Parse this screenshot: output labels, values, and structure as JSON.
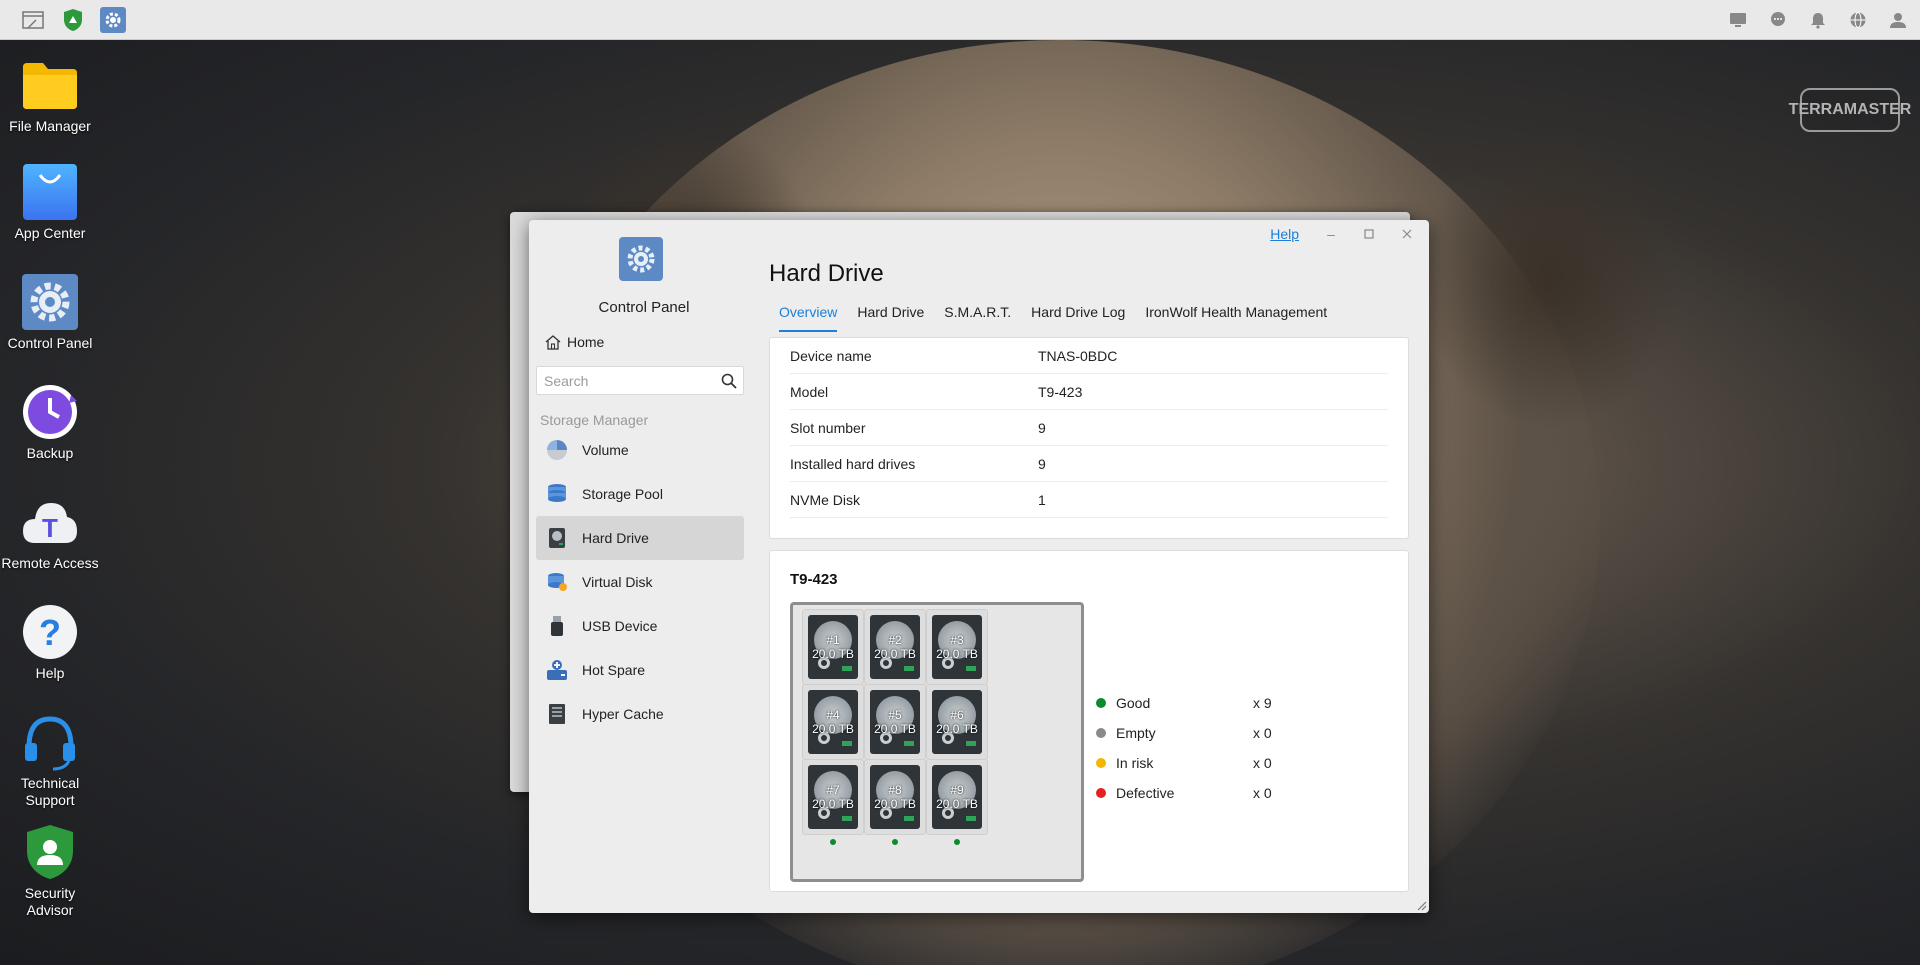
{
  "taskbar": {
    "right_icons": [
      "monitor-icon",
      "chat-icon",
      "bell-icon",
      "globe-icon",
      "user-icon"
    ]
  },
  "desktop": {
    "items": [
      {
        "label": "File Manager",
        "icon": "folder-icon"
      },
      {
        "label": "App Center",
        "icon": "shopping-bag-icon"
      },
      {
        "label": "Control Panel",
        "icon": "gear-icon"
      },
      {
        "label": "Backup",
        "icon": "clock-icon"
      },
      {
        "label": "Remote Access",
        "icon": "cloud-icon"
      },
      {
        "label": "Help",
        "icon": "question-icon"
      },
      {
        "label": "Technical Support",
        "icon": "headset-icon"
      },
      {
        "label": "Security Advisor",
        "icon": "shield-icon"
      }
    ],
    "brand": "TERRAMASTER"
  },
  "window": {
    "help_label": "Help",
    "sidebar": {
      "app_title": "Control Panel",
      "home_label": "Home",
      "search_placeholder": "Search",
      "section_title": "Storage Manager",
      "items": [
        {
          "label": "Volume",
          "icon": "pie-icon"
        },
        {
          "label": "Storage Pool",
          "icon": "database-icon"
        },
        {
          "label": "Hard Drive",
          "icon": "hard-drive-icon",
          "active": true
        },
        {
          "label": "Virtual Disk",
          "icon": "virtual-disk-icon"
        },
        {
          "label": "USB Device",
          "icon": "usb-icon"
        },
        {
          "label": "Hot Spare",
          "icon": "hot-spare-icon"
        },
        {
          "label": "Hyper Cache",
          "icon": "cache-icon"
        }
      ]
    },
    "main": {
      "title": "Hard Drive",
      "tabs": [
        "Overview",
        "Hard Drive",
        "S.M.A.R.T.",
        "Hard Drive Log",
        "IronWolf Health Management"
      ],
      "active_tab": "Overview",
      "info": [
        {
          "key": "Device name",
          "value": "TNAS-0BDC"
        },
        {
          "key": "Model",
          "value": "T9-423"
        },
        {
          "key": "Slot number",
          "value": "9"
        },
        {
          "key": "Installed hard drives",
          "value": "9"
        },
        {
          "key": "NVMe Disk",
          "value": "1"
        }
      ],
      "device": {
        "title": "T9-423",
        "drives": [
          {
            "slot": "#1",
            "size": "20.0 TB"
          },
          {
            "slot": "#2",
            "size": "20.0 TB"
          },
          {
            "slot": "#3",
            "size": "20.0 TB"
          },
          {
            "slot": "#4",
            "size": "20.0 TB"
          },
          {
            "slot": "#5",
            "size": "20.0 TB"
          },
          {
            "slot": "#6",
            "size": "20.0 TB"
          },
          {
            "slot": "#7",
            "size": "20.0 TB"
          },
          {
            "slot": "#8",
            "size": "20.0 TB"
          },
          {
            "slot": "#9",
            "size": "20.0 TB"
          }
        ],
        "legend": [
          {
            "label": "Good",
            "count": "x 9",
            "color": "#0c8a2e"
          },
          {
            "label": "Empty",
            "count": "x 0",
            "color": "#8a8a8a"
          },
          {
            "label": "In risk",
            "count": "x 0",
            "color": "#f2b705"
          },
          {
            "label": "Defective",
            "count": "x 0",
            "color": "#e32222"
          }
        ]
      }
    }
  },
  "colors": {
    "accent": "#1a7fd8",
    "good": "#0c8a2e"
  }
}
